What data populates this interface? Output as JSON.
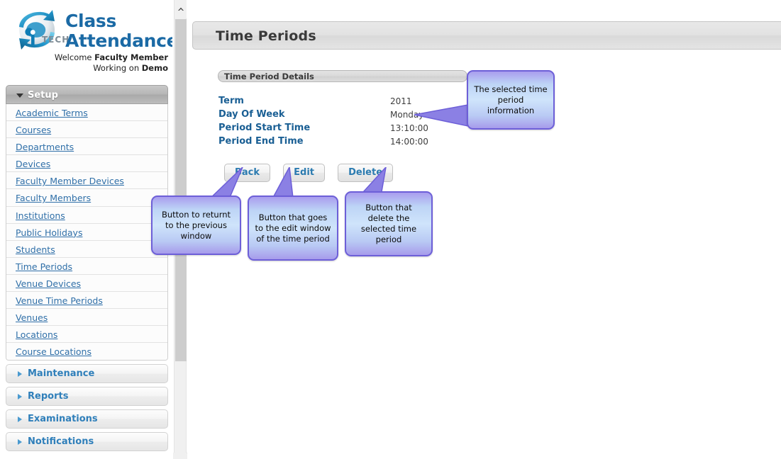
{
  "brand": {
    "line1": "Class",
    "line2": "Attendance",
    "logo_primary": "ip-tech-globe-logo",
    "logo_text": "TECH",
    "welcome_prefix": "Welcome ",
    "welcome_user": "Faculty Member",
    "working_prefix": "Working on ",
    "working_value": "Demo"
  },
  "sidebar": {
    "setup": {
      "label": "Setup",
      "expanded": true,
      "items": [
        {
          "label": "Academic Terms"
        },
        {
          "label": "Courses"
        },
        {
          "label": "Departments"
        },
        {
          "label": "Devices"
        },
        {
          "label": "Faculty Member Devices"
        },
        {
          "label": "Faculty Members"
        },
        {
          "label": "Institutions"
        },
        {
          "label": "Public Holidays"
        },
        {
          "label": "Students"
        },
        {
          "label": "Time Periods"
        },
        {
          "label": "Venue Devices"
        },
        {
          "label": "Venue Time Periods"
        },
        {
          "label": "Venues"
        },
        {
          "label": "Locations"
        },
        {
          "label": "Course Locations"
        }
      ]
    },
    "sections": [
      {
        "label": "Maintenance"
      },
      {
        "label": "Reports"
      },
      {
        "label": "Examinations"
      },
      {
        "label": "Notifications"
      }
    ]
  },
  "main": {
    "page_title": "Time Periods",
    "panel_title": "Time Period Details",
    "details": [
      {
        "label": "Term",
        "value": "2011"
      },
      {
        "label": "Day Of Week",
        "value": "Monday"
      },
      {
        "label": "Period Start Time",
        "value": "13:10:00"
      },
      {
        "label": "Period End Time",
        "value": "14:00:00"
      }
    ],
    "buttons": [
      {
        "label": "Back"
      },
      {
        "label": "Edit"
      },
      {
        "label": "Delete"
      }
    ]
  },
  "callouts": [
    {
      "id": "info",
      "text": "The selected time period information"
    },
    {
      "id": "back",
      "text": "Button to returnt to the previous window"
    },
    {
      "id": "edit",
      "text": "Button that goes to the edit window of the time period"
    },
    {
      "id": "delete",
      "text": "Button that delete the selected time period"
    }
  ],
  "colors": {
    "brand_blue": "#1b6aa5",
    "link_blue": "#2f6fa8",
    "label_blue": "#1a5f94",
    "button_text": "#2b7bb0",
    "callout_border": "#6d5fd8",
    "callout_fill": "#cfe4fb"
  },
  "scrollbar": {
    "up_arrow": "chevron-up-icon"
  }
}
